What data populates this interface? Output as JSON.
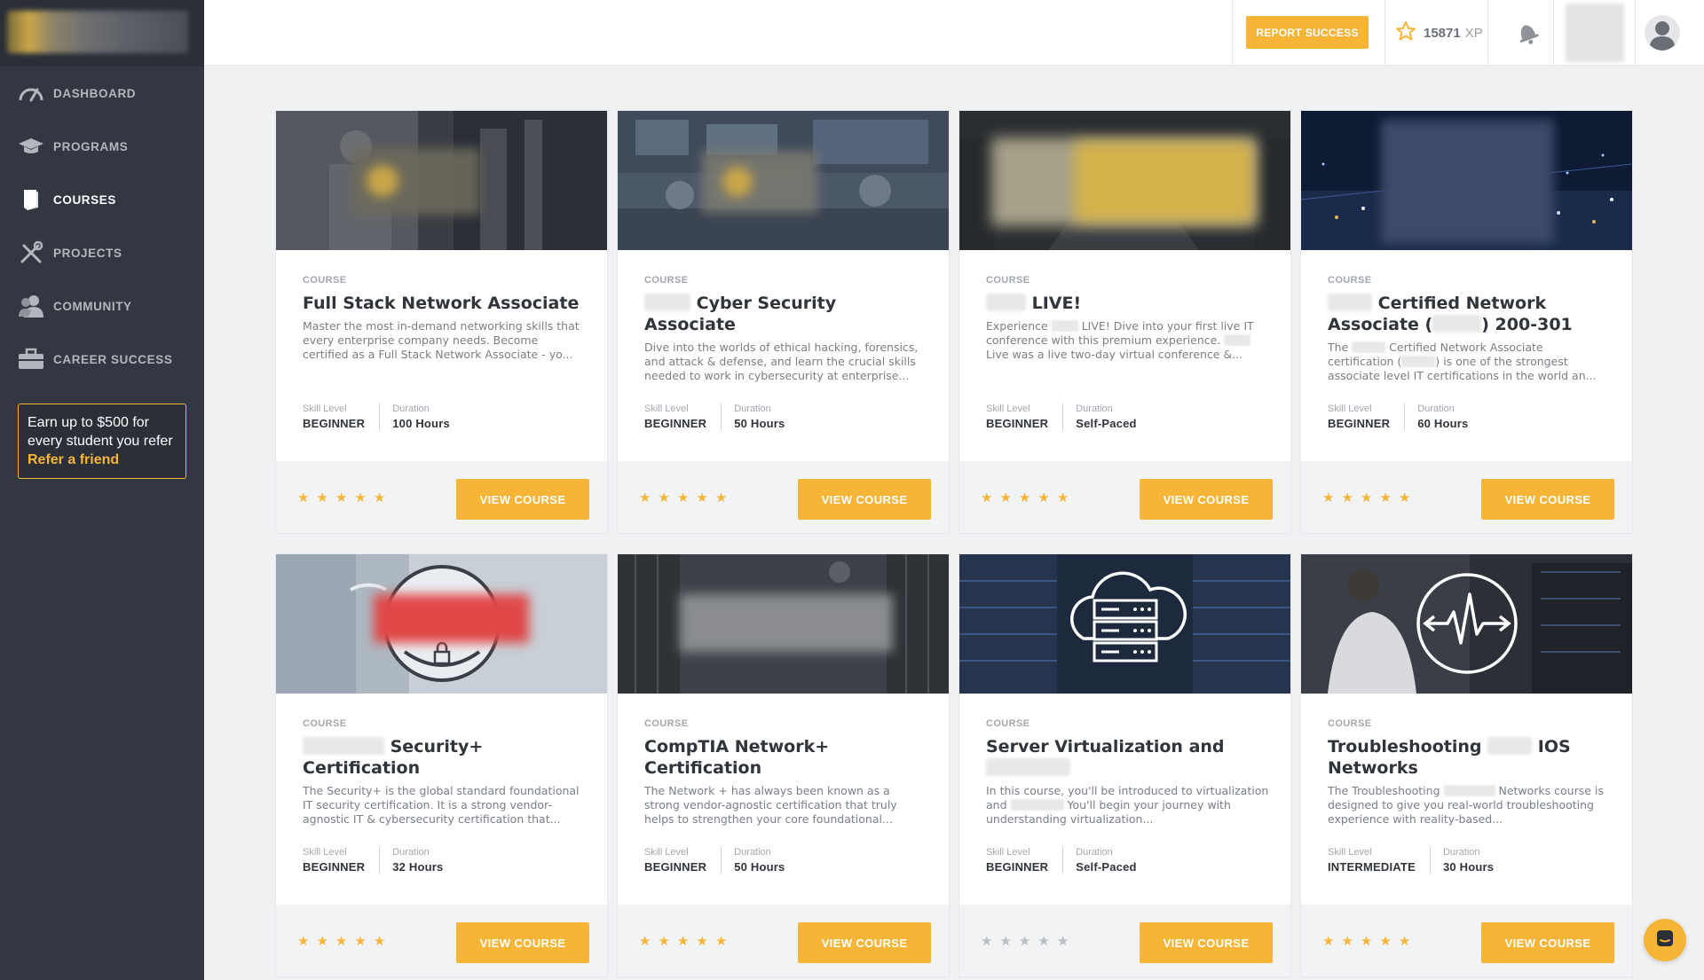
{
  "sidebar": {
    "items": [
      {
        "label": "DASHBOARD",
        "icon": "speedometer-icon"
      },
      {
        "label": "PROGRAMS",
        "icon": "graduation-cap-icon"
      },
      {
        "label": "COURSES",
        "icon": "book-icon"
      },
      {
        "label": "PROJECTS",
        "icon": "tools-icon"
      },
      {
        "label": "COMMUNITY",
        "icon": "users-icon"
      },
      {
        "label": "CAREER SUCCESS",
        "icon": "briefcase-icon"
      }
    ],
    "active": "COURSES",
    "refer": {
      "text": "Earn up to $500 for every student you refer",
      "link": "Refer a friend"
    }
  },
  "topbar": {
    "report_button": "REPORT SUCCESS",
    "xp_value": "15871",
    "xp_unit": "XP"
  },
  "colors": {
    "accent": "#f7b538",
    "sidebar": "#323741",
    "text_dark": "#30343b"
  },
  "common": {
    "kind": "COURSE",
    "skill_label": "Skill Level",
    "duration_label": "Duration",
    "view_button": "VIEW COURSE",
    "star": "★"
  },
  "courses": [
    {
      "title": "Full Stack Network Associate",
      "desc": "Master the most in-demand networking skills that every enterprise company needs. Become certified as a Full Stack Network Associate - yo...",
      "skill": "BEGINNER",
      "duration": "100 Hours",
      "rated": true
    },
    {
      "title": "Cyber Security Associate",
      "desc": "Dive into the worlds of ethical hacking, forensics, and attack & defense, and learn the crucial skills needed to work in cybersecurity at enterprise...",
      "skill": "BEGINNER",
      "duration": "50 Hours",
      "rated": true
    },
    {
      "title": "LIVE!",
      "desc_a": "Experience",
      "desc_b": "LIVE! Dive into your first live IT conference with this premium experience.",
      "desc_c": "Live was a live two-day virtual conference &...",
      "skill": "BEGINNER",
      "duration": "Self-Paced",
      "rated": true
    },
    {
      "title_a": "Certified Network Associate (",
      "title_b": ") 200-301",
      "desc_a": "The",
      "desc_b": "Certified Network Associate certification (",
      "desc_c": ") is one of the strongest associate level IT certifications in the world an...",
      "skill": "BEGINNER",
      "duration": "60 Hours",
      "rated": true
    },
    {
      "title": "Security+ Certification",
      "desc": "The Security+ is the global standard foundational IT security certification. It is a strong vendor-agnostic IT & cybersecurity certification that...",
      "skill": "BEGINNER",
      "duration": "32 Hours",
      "rated": true
    },
    {
      "title": "CompTIA Network+ Certification",
      "desc": "The Network + has always been known as a strong vendor-agnostic certification that truly helps to strengthen your core foundational...",
      "skill": "BEGINNER",
      "duration": "50 Hours",
      "rated": true
    },
    {
      "title": "Server Virtualization and",
      "desc_a": "In this course, you'll be introduced to virtualization and",
      "desc_b": "You'll begin your journey with understanding virtualization...",
      "skill": "BEGINNER",
      "duration": "Self-Paced",
      "rated": false
    },
    {
      "title_a": "Troubleshooting",
      "title_b": "IOS Networks",
      "desc_a": "The Troubleshooting",
      "desc_b": "Networks course is designed to give you real-world troubleshooting experience with reality-based...",
      "skill": "INTERMEDIATE",
      "duration": "30 Hours",
      "rated": true
    }
  ]
}
